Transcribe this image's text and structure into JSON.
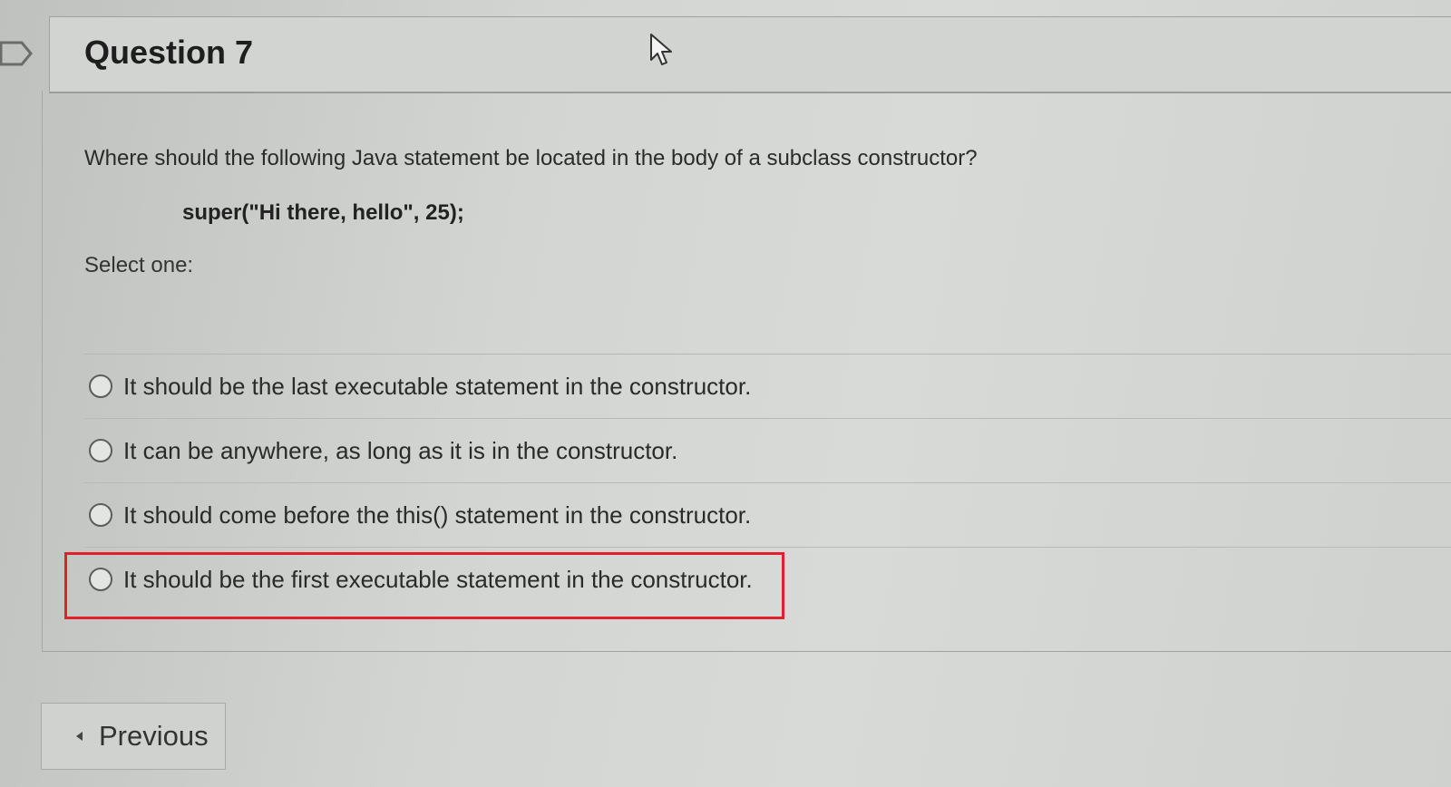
{
  "question": {
    "title": "Question 7",
    "prompt": "Where should the following Java statement be located in the body of a subclass constructor?",
    "code": "super(\"Hi there, hello\", 25);",
    "select_label": "Select one:",
    "options": [
      {
        "label": "It should be the last executable statement in the constructor."
      },
      {
        "label": "It can be anywhere, as long as it is in the constructor."
      },
      {
        "label": "It should come before the this() statement in the constructor."
      },
      {
        "label": "It should be the first executable statement in the constructor."
      }
    ]
  },
  "navigation": {
    "previous_label": "Previous"
  },
  "icons": {
    "flag": "flag-icon",
    "cursor": "mouse-cursor-icon",
    "previous": "chevron-left-icon"
  },
  "colors": {
    "highlight": "#e0202a"
  }
}
